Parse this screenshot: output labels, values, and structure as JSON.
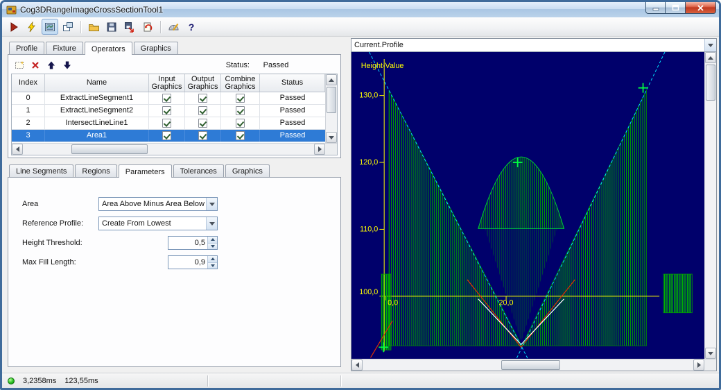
{
  "window": {
    "title": "Cog3DRangeImageCrossSectionTool1"
  },
  "toolbar": {
    "icons": [
      "run-icon",
      "live-run-lightning-icon",
      "show-image-icon",
      "float-display-icon",
      "open-folder-icon",
      "save-icon",
      "save-image-icon",
      "reset-icon",
      "protractor-pencil-icon",
      "help-icon"
    ],
    "help_glyph": "?"
  },
  "main_tabs": {
    "items": [
      "Profile",
      "Fixture",
      "Operators",
      "Graphics"
    ],
    "selected": "Operators"
  },
  "operators": {
    "toolbar_icons": [
      "add-operator-icon",
      "delete-operator-icon",
      "move-up-icon",
      "move-down-icon"
    ],
    "status_label": "Status:",
    "status_value": "Passed",
    "grid": {
      "columns": [
        "Index",
        "Name",
        "Input Graphics",
        "Output Graphics",
        "Combine Graphics",
        "Status"
      ],
      "rows": [
        {
          "index": "0",
          "name": "ExtractLineSegment1",
          "input_graphics": true,
          "output_graphics": true,
          "combine_graphics": true,
          "status": "Passed",
          "selected": false
        },
        {
          "index": "1",
          "name": "ExtractLineSegment2",
          "input_graphics": true,
          "output_graphics": true,
          "combine_graphics": true,
          "status": "Passed",
          "selected": false
        },
        {
          "index": "2",
          "name": "IntersectLineLine1",
          "input_graphics": true,
          "output_graphics": true,
          "combine_graphics": true,
          "status": "Passed",
          "selected": false
        },
        {
          "index": "3",
          "name": "Area1",
          "input_graphics": true,
          "output_graphics": true,
          "combine_graphics": true,
          "status": "Passed",
          "selected": true
        }
      ]
    }
  },
  "sub_tabs": {
    "items": [
      "Line Segments",
      "Regions",
      "Parameters",
      "Tolerances",
      "Graphics"
    ],
    "selected": "Parameters"
  },
  "parameters": {
    "area_label": "Area",
    "area_value": "Area Above Minus Area Below",
    "reference_profile_label": "Reference Profile:",
    "reference_profile_value": "Create From Lowest",
    "height_threshold_label": "Height Threshold:",
    "height_threshold_value": "0,5",
    "max_fill_length_label": "Max Fill Length:",
    "max_fill_length_value": "0,9"
  },
  "display": {
    "profile_selector_value": "Current.Profile",
    "chart": {
      "type": "profile-cross-section",
      "ylabel": "Height-Value",
      "y_ticks": [
        "130,0",
        "120,0",
        "110,0",
        "100,0"
      ],
      "y_values": [
        130,
        120,
        110,
        100
      ],
      "x_ticks": [
        "0,0",
        "20,0"
      ],
      "x_values": [
        0,
        20
      ],
      "description": "V-shaped height profile with hatched area fill between profile and lowest reference, two fitted line segments (dashed) intersecting at the valley bottom, green cross markers",
      "colors": {
        "background": "#00006b",
        "axis": "#ffff00",
        "area_hatch": "#00a000",
        "fitted_line": "#00e0ff",
        "marker": "#00ff40",
        "profile": "#ffffff",
        "profile_alt": "#e03000"
      }
    }
  },
  "status_bar": {
    "time1": "3,2358ms",
    "time2": "123,55ms"
  }
}
